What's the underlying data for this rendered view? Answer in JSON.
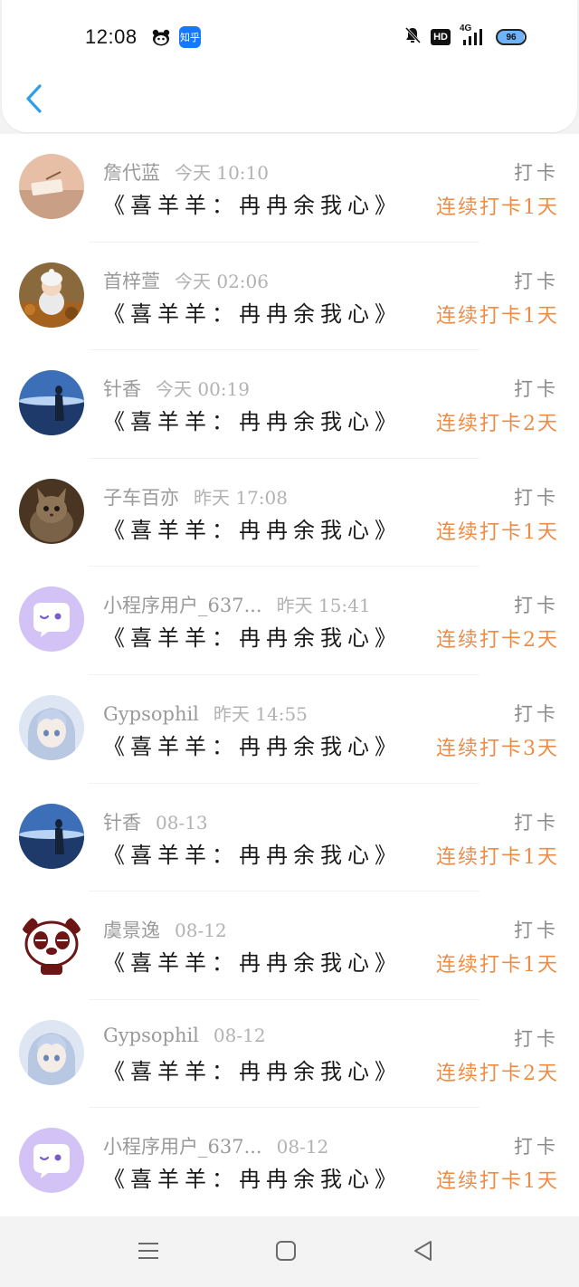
{
  "status_bar": {
    "time": "12:08",
    "app_icons": [
      "panda-icon",
      "zhihu-icon"
    ],
    "zhihu_label": "知乎",
    "network": "4G",
    "hd": "HD",
    "battery": "96"
  },
  "header": {
    "back_icon": "chevron-left-icon",
    "accent_color": "#2f9ee8"
  },
  "colors": {
    "streak": "#ee8b45",
    "username": "#9a9a9a",
    "title": "#1a1a1a"
  },
  "records": [
    {
      "user": "詹代蓝",
      "time": "今天 10:10",
      "title": "《喜羊羊：冉冉余我心》",
      "action": "打卡",
      "streak": "连续打卡1天",
      "avatar": "avatar-book"
    },
    {
      "user": "首梓萱",
      "time": "今天 02:06",
      "title": "《喜羊羊：冉冉余我心》",
      "action": "打卡",
      "streak": "连续打卡1天",
      "avatar": "avatar-baby"
    },
    {
      "user": "针香",
      "time": "今天 00:19",
      "title": "《喜羊羊：冉冉余我心》",
      "action": "打卡",
      "streak": "连续打卡2天",
      "avatar": "avatar-sea"
    },
    {
      "user": "子车百亦",
      "time": "昨天 17:08",
      "title": "《喜羊羊：冉冉余我心》",
      "action": "打卡",
      "streak": "连续打卡1天",
      "avatar": "avatar-cat"
    },
    {
      "user": "小程序用户_637...",
      "time": "昨天 15:41",
      "title": "《喜羊羊：冉冉余我心》",
      "action": "打卡",
      "streak": "连续打卡2天",
      "avatar": "avatar-chat"
    },
    {
      "user": "Gypsophil",
      "time": "昨天 14:55",
      "title": "《喜羊羊：冉冉余我心》",
      "action": "打卡",
      "streak": "连续打卡3天",
      "avatar": "avatar-anime"
    },
    {
      "user": "针香",
      "time": "08-13",
      "title": "《喜羊羊：冉冉余我心》",
      "action": "打卡",
      "streak": "连续打卡1天",
      "avatar": "avatar-sea"
    },
    {
      "user": "虞景逸",
      "time": "08-12",
      "title": "《喜羊羊：冉冉余我心》",
      "action": "打卡",
      "streak": "连续打卡1天",
      "avatar": "avatar-panda"
    },
    {
      "user": "Gypsophil",
      "time": "08-12",
      "title": "《喜羊羊：冉冉余我心》",
      "action": "打卡",
      "streak": "连续打卡2天",
      "avatar": "avatar-anime"
    },
    {
      "user": "小程序用户_637...",
      "time": "08-12",
      "title": "《喜羊羊：冉冉余我心》",
      "action": "打卡",
      "streak": "连续打卡1天",
      "avatar": "avatar-chat"
    }
  ],
  "system_nav": {
    "icons": [
      "menu-icon",
      "home-square-icon",
      "back-triangle-icon"
    ]
  }
}
